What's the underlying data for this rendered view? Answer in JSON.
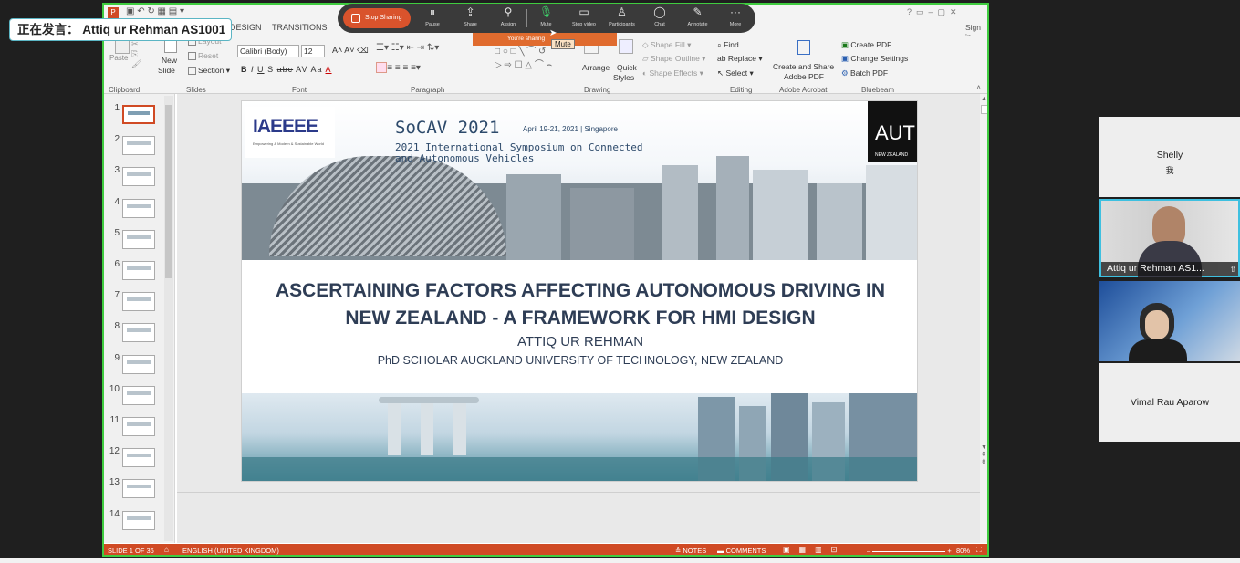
{
  "speaker_banner": {
    "prefix": "正在发言：",
    "name": "Attiq ur Rehman AS1001"
  },
  "zoom_bar": {
    "stop_label": "Stop Sharing",
    "items": [
      {
        "label": "Pause",
        "icon": "pause-icon"
      },
      {
        "label": "Share",
        "icon": "share-icon"
      },
      {
        "label": "Assign",
        "icon": "assign-icon"
      },
      {
        "label": "Mute",
        "icon": "microphone-icon"
      },
      {
        "label": "Stop video",
        "icon": "camera-icon"
      },
      {
        "label": "Participants",
        "icon": "participants-icon"
      },
      {
        "label": "Chat",
        "icon": "chat-icon"
      },
      {
        "label": "Annotate",
        "icon": "annotate-icon"
      },
      {
        "label": "More",
        "icon": "more-icon"
      }
    ],
    "sharing_text": "You're sharing",
    "tooltip": "Mute"
  },
  "ppt": {
    "tabs": [
      "DESIGN",
      "TRANSITIONS"
    ],
    "sign_in": "Sign in",
    "clipboard": {
      "paste": "Paste",
      "label": "Clipboard"
    },
    "slides": {
      "new": "New",
      "slide": "Slide",
      "layout": "Layout",
      "reset": "Reset",
      "section": "Section",
      "label": "Slides"
    },
    "font": {
      "family": "Calibri (Body)",
      "size": "12",
      "label": "Font",
      "fmt": [
        "B",
        "I",
        "U",
        "S",
        "abc",
        "AV",
        "Aa",
        "A"
      ]
    },
    "paragraph": {
      "label": "Paragraph"
    },
    "drawing": {
      "arrange": "Arrange",
      "quick": "Quick",
      "styles": "Styles",
      "fill": "Shape Fill",
      "outline": "Shape Outline",
      "effects": "Shape Effects",
      "label": "Drawing"
    },
    "editing": {
      "find": "Find",
      "replace": "Replace",
      "select": "Select",
      "label": "Editing"
    },
    "acrobat": {
      "l1": "Create and Share",
      "l2": "Adobe PDF",
      "label": "Adobe Acrobat"
    },
    "bluebeam": {
      "create": "Create PDF",
      "change": "Change Settings",
      "batch": "Batch PDF",
      "label": "Bluebeam"
    },
    "thumbs": [
      "1",
      "2",
      "3",
      "4",
      "5",
      "6",
      "7",
      "8",
      "9",
      "10",
      "11",
      "12",
      "13",
      "14"
    ],
    "status": {
      "slide": "SLIDE 1 OF 36",
      "lang": "ENGLISH (UNITED KINGDOM)",
      "notes": "NOTES",
      "comments": "COMMENTS",
      "zoom": "80%"
    }
  },
  "slide": {
    "logo_text": "IAEEEE",
    "logo_sub": "Empowering & Modern & Sustainable World",
    "conf": "SoCAV 2021",
    "dates": "April 19-21, 2021 | Singapore",
    "conf_line1": "2021 International Symposium on Connected",
    "conf_line2": "and Autonomous Vehicles",
    "aut": "AUT",
    "aut_sub": "NEW ZEALAND",
    "title1": "ASCERTAINING FACTORS AFFECTING AUTONOMOUS DRIVING IN",
    "title2": "NEW ZEALAND - A FRAMEWORK FOR HMI DESIGN",
    "author": "ATTIQ UR REHMAN",
    "affil": "PhD SCHOLAR AUCKLAND UNIVERSITY OF TECHNOLOGY, NEW ZEALAND"
  },
  "participants": [
    {
      "name": "Shelly",
      "sub": "我"
    },
    {
      "name": "Attiq ur Rehman AS1..."
    },
    {
      "name": ""
    },
    {
      "name": "Vimal Rau Aparow"
    }
  ]
}
